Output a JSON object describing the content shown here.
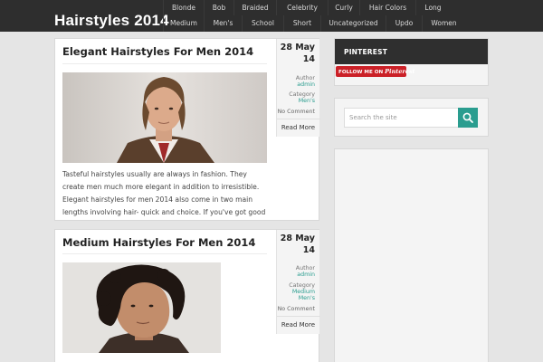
{
  "site": {
    "title": "Hairstyles 2014"
  },
  "nav": {
    "row1": [
      "Blonde",
      "Bob",
      "Braided",
      "Celebrity",
      "Curly",
      "Hair Colors",
      "Long"
    ],
    "row2": [
      "Medium",
      "Men's",
      "School",
      "Short",
      "Uncategorized",
      "Updo",
      "Women"
    ]
  },
  "posts": [
    {
      "title": "Elegant Hairstyles For Men 2014",
      "date_day": "28 May",
      "date_year": "14",
      "author_label": "Author",
      "author": "admin",
      "category_label": "Category",
      "categories": [
        "Men's"
      ],
      "comments": "No Comment",
      "read_more": "Read More",
      "excerpt": "Tasteful hairstyles usually are always in fashion. They create men much more elegant in addition to irresistible. Elegant hairstyles for men 2014 also come in two main lengths involving hair- quick and choice. If you've got good"
    },
    {
      "title": "Medium Hairstyles For Men 2014",
      "date_day": "28 May",
      "date_year": "14",
      "author_label": "Author",
      "author": "admin",
      "category_label": "Category",
      "categories": [
        "Medium",
        "Men's"
      ],
      "comments": "No Comment",
      "read_more": "Read More"
    }
  ],
  "sidebar": {
    "pinterest_title": "PINTEREST",
    "pinterest_button_prefix": "FOLLOW ME ON",
    "pinterest_button_brand": "Pinterest",
    "search_placeholder": "Search the site"
  },
  "colors": {
    "accent": "#2a9d8f",
    "header": "#2e2e2e",
    "pinterest": "#cb2027"
  },
  "icons": {
    "search": "search-icon"
  }
}
